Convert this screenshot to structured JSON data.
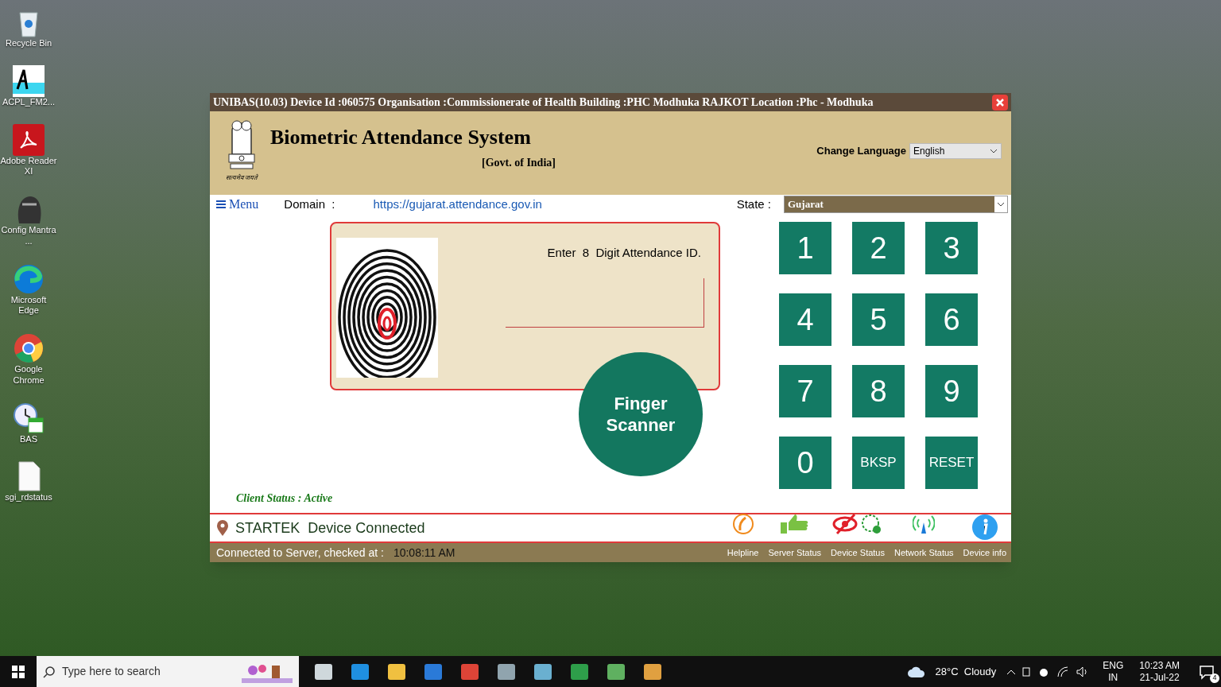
{
  "desktop_icons": [
    {
      "label": "Recycle Bin",
      "kind": "bin"
    },
    {
      "label": "ACPL_FM2...",
      "kind": "access"
    },
    {
      "label": "Adobe Reader XI",
      "kind": "pdf"
    },
    {
      "label": "Config Mantra ...",
      "kind": "device"
    },
    {
      "label": "Microsoft Edge",
      "kind": "edge"
    },
    {
      "label": "Google Chrome",
      "kind": "chrome"
    },
    {
      "label": "BAS",
      "kind": "clock"
    },
    {
      "label": "sgi_rdstatus",
      "kind": "file"
    }
  ],
  "window": {
    "title": "UNIBAS(10.03) Device Id :060575 Organisation :Commissionerate of Health Building :PHC Modhuka RAJKOT Location :Phc - Modhuka",
    "header": {
      "title": "Biometric Attendance System",
      "subtitle": "[Govt. of India]",
      "emblem_caption": "सत्यमेव जयते",
      "language_label": "Change Language",
      "language_value": "English"
    },
    "menu_label": "Menu",
    "domain_label": "Domain  :",
    "domain_value": "https://gujarat.attendance.gov.in",
    "state_label": "State :",
    "state_value": "Gujarat",
    "prompt": "Enter  8  Digit Attendance ID.",
    "keypad": [
      {
        "label": "1",
        "kind": "digit"
      },
      {
        "label": "2",
        "kind": "digit"
      },
      {
        "label": "3",
        "kind": "digit"
      },
      {
        "label": "4",
        "kind": "digit"
      },
      {
        "label": "5",
        "kind": "digit"
      },
      {
        "label": "6",
        "kind": "digit"
      },
      {
        "label": "7",
        "kind": "digit"
      },
      {
        "label": "8",
        "kind": "digit"
      },
      {
        "label": "9",
        "kind": "digit"
      },
      {
        "label": "0",
        "kind": "digit"
      },
      {
        "label": "BKSP",
        "kind": "action"
      },
      {
        "label": "RESET",
        "kind": "action"
      }
    ],
    "scanner_button": "Finger Scanner",
    "client_status": "Client Status : Active",
    "device_status": "STARTEK  Device Connected",
    "connection_label": "Connected to Server, checked at :",
    "connection_time": "10:08:11 AM",
    "status_icons": [
      {
        "label": "Helpline",
        "kind": "phone"
      },
      {
        "label": "Server Status",
        "kind": "thumb"
      },
      {
        "label": "Device Status",
        "kind": "device"
      },
      {
        "label": "Network Status",
        "kind": "signal"
      },
      {
        "label": "Device info",
        "kind": "info"
      }
    ]
  },
  "taskbar": {
    "search_placeholder": "Type here to search",
    "weather": "28°C  Cloudy",
    "language": "ENG",
    "region": "IN",
    "time": "10:23 AM",
    "date": "21-Jul-22",
    "notifications": "4"
  }
}
